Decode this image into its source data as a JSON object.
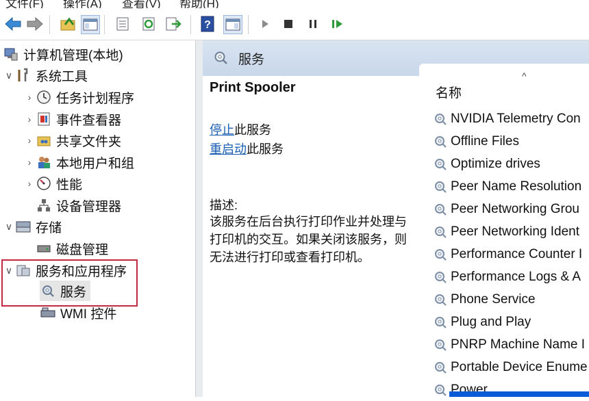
{
  "menubar": {
    "items": [
      "文件(F)",
      "操作(A)",
      "查看(V)",
      "帮助(H)"
    ]
  },
  "toolbar": {
    "buttons": [
      "back-icon",
      "forward-icon",
      "up-folder-icon",
      "show-tree-icon",
      "properties-icon",
      "refresh-icon",
      "export-icon",
      "help-icon",
      "show-action-pane-icon",
      "play-icon",
      "stop-icon",
      "pause-icon",
      "resume-icon"
    ]
  },
  "tree": {
    "items": [
      {
        "label": "计算机管理(本地)",
        "icon": "computer-management-icon",
        "expander": ""
      },
      {
        "label": "系统工具",
        "icon": "tools-icon",
        "expander": "∨"
      },
      {
        "label": "任务计划程序",
        "icon": "clock-icon",
        "expander": "›"
      },
      {
        "label": "事件查看器",
        "icon": "event-viewer-icon",
        "expander": "›"
      },
      {
        "label": "共享文件夹",
        "icon": "shared-folder-icon",
        "expander": "›"
      },
      {
        "label": "本地用户和组",
        "icon": "users-icon",
        "expander": "›"
      },
      {
        "label": "性能",
        "icon": "performance-icon",
        "expander": "›"
      },
      {
        "label": "设备管理器",
        "icon": "device-manager-icon",
        "expander": ""
      },
      {
        "label": "存储",
        "icon": "storage-icon",
        "expander": "∨"
      },
      {
        "label": "磁盘管理",
        "icon": "disk-icon",
        "expander": ""
      },
      {
        "label": "服务和应用程序",
        "icon": "services-apps-icon",
        "expander": "∨"
      },
      {
        "label": "服务",
        "icon": "service-gear-icon",
        "expander": ""
      },
      {
        "label": "WMI 控件",
        "icon": "wmi-icon",
        "expander": ""
      }
    ]
  },
  "main": {
    "header_title": "服务",
    "detail": {
      "service_name": "Print Spooler",
      "stop_link": "停止",
      "stop_suffix": "此服务",
      "restart_link": "重启动",
      "restart_suffix": "此服务",
      "description_label": "描述:",
      "description_text": "该服务在后台执行打印作业并处理与打印机的交互。如果关闭该服务，则无法进行打印或查看打印机。"
    },
    "list": {
      "column_name": "名称",
      "sort_indicator": "^",
      "rows": [
        "NVIDIA Telemetry Con",
        "Offline Files",
        "Optimize drives",
        "Peer Name Resolution",
        "Peer Networking Grou",
        "Peer Networking Ident",
        "Performance Counter I",
        "Performance Logs & A",
        "Phone Service",
        "Plug and Play",
        "PNRP Machine Name I",
        "Portable Device Enume",
        "Power"
      ]
    }
  },
  "colors": {
    "highlight_box": "#c0293f",
    "link": "#1a5fb4",
    "header_gradient": "#d9e4f1",
    "selection": "#0a5bd8"
  }
}
